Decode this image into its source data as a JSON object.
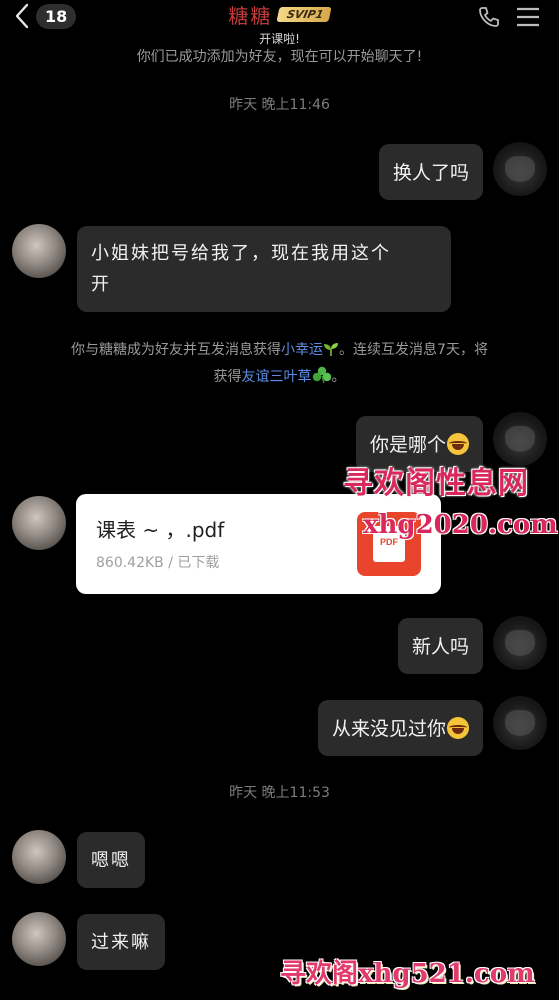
{
  "header": {
    "back_count": "18",
    "title": "糖糖",
    "vip_badge": "SVIP1",
    "subtitle": "开课啦!"
  },
  "system_message": "你们已成功添加为好友，现在可以开始聊天了!",
  "timestamps": [
    "昨天 晚上11:46",
    "昨天 晚上11:53"
  ],
  "messages": [
    {
      "side": "right",
      "text": "换人了吗"
    },
    {
      "side": "left",
      "text_line1": "小姐妹把号给我了，现在我用这个",
      "text_line2": "开"
    },
    {
      "side": "right",
      "text": "你是哪个",
      "emoji": "laugh-cry"
    },
    {
      "side": "left",
      "type": "file",
      "file_name": "课表 ~ ，.pdf",
      "file_meta": "860.42KB / 已下载",
      "file_icon_label": "PDF"
    },
    {
      "side": "right",
      "text": "新人吗"
    },
    {
      "side": "right",
      "text": "从来没见过你",
      "emoji": "laugh-cry"
    },
    {
      "side": "left",
      "text": "嗯嗯"
    },
    {
      "side": "left",
      "text": "过来嘛"
    }
  ],
  "friendship_notice": {
    "part1": "你与糖糖成为好友并互发消息获得",
    "link1": "小幸运",
    "part2": "。连续互发消息7天，将",
    "part3": "获得",
    "link2": "友谊三叶草",
    "part4": "。"
  },
  "watermarks": {
    "text1": "寻欢阁性息网",
    "text2": "xhg2020.com",
    "text3": "寻欢阁xhg521.com"
  },
  "colors": {
    "background": "#000000",
    "bubble": "#2b2b2b",
    "title": "#c23b3b",
    "link": "#5c8ee6",
    "watermark": "#d8285c"
  }
}
